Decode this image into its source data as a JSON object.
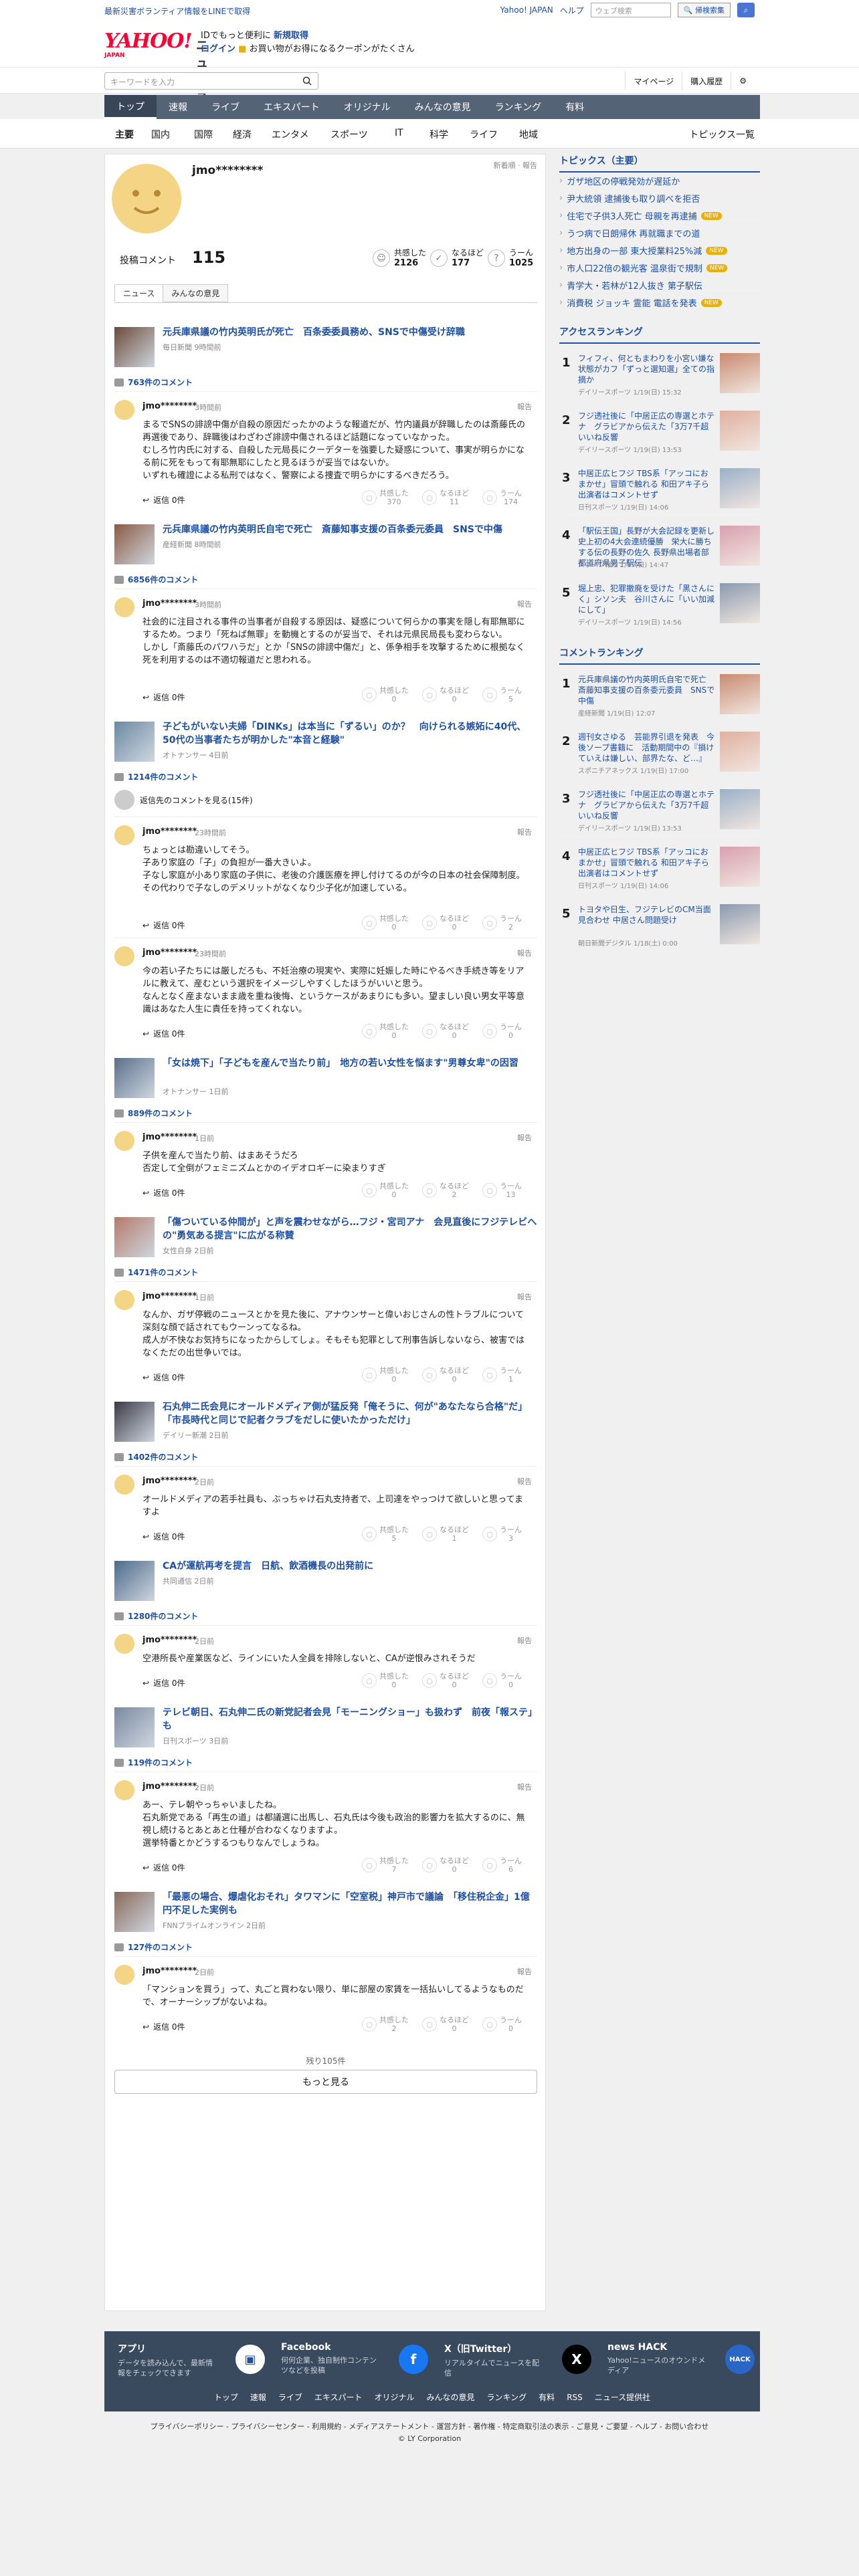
{
  "top_notice": {
    "left": "最新災害ボランティア情報をLINEで取得",
    "links": [
      "Yahoo! JAPAN",
      "ヘルプ"
    ],
    "search_placeholder": "ウェブ検索",
    "search_button": "🔍 帰検索集"
  },
  "header": {
    "logo_main": "YAHOO!",
    "logo_news": "ニュース",
    "logo_jp": "JAPAN",
    "promo_line1_a": "IDでもっと便利に",
    "promo_line1_b": "新規取得",
    "promo_line2_a": "ログイン",
    "promo_line2_b": "お買い物がお得になるクーポンがたくさん"
  },
  "search": {
    "placeholder": "キーワードを入力",
    "links": [
      "マイページ",
      "購入履歴"
    ]
  },
  "gnav": [
    "トップ",
    "速報",
    "ライブ",
    "エキスパート",
    "オリジナル",
    "みんなの意見",
    "ランキング",
    "有料"
  ],
  "subnav": [
    "主要",
    "国内",
    "国際",
    "経済",
    "エンタメ",
    "スポーツ",
    "IT",
    "科学",
    "ライフ",
    "地域"
  ],
  "topics_all": "トピックス一覧",
  "profile": {
    "name": "jmo********",
    "note": "新着順 · 報告",
    "post_label": "投稿コメント",
    "post_count": "115",
    "stats": [
      {
        "label": "共感した",
        "value": "2126"
      },
      {
        "label": "なるほど",
        "value": "177"
      },
      {
        "label": "うーん",
        "value": "1025"
      }
    ],
    "tabs": [
      "ニュース",
      "みんなの意見"
    ]
  },
  "articles": [
    {
      "title": "元兵庫県議の竹内英明氏が死亡　百条委委員務め、SNSで中傷受け辞職",
      "source": "毎日新聞 9時間前",
      "comments": "763件のコメント",
      "entries": [
        {
          "user": "jmo********",
          "time": "3時間前",
          "text": "まるでSNSの誹謗中傷が自殺の原因だったかのような報道だが、竹内議員が辞職したのは斎藤氏の再選後であり、辞職後はわざわざ誹謗中傷されるほど話題になっていなかった。\nむしろ竹内氏に対する、自殺した元局長にクーデターを強要した疑惑について、事実が明らかになる前に死をもって有耶無耶にしたと見るほうが妥当ではないか。\nいずれも確證による私刑ではなく、警察による捜査で明らかにするべきだろう。",
          "r": [
            "370",
            "11",
            "174"
          ]
        }
      ]
    },
    {
      "title": "元兵庫県議の竹内英明氏自宅で死亡　斎藤知事支援の百条委元委員　SNSで中傷",
      "source": "産経新聞 8時間前",
      "comments": "6856件のコメント",
      "entries": [
        {
          "user": "jmo********",
          "time": "3時間前",
          "text": "社会的に注目される事件の当事者が自殺する原因は、疑惑について何らかの事実を隠し有耶無耶にするため。つまり「死ねば無罪」を動機とするのが妥当で、それは元県民局長も変わらない。\nしかし「斎藤氏のパワハラだ」とか「SNSの誹謗中傷だ」と、係争相手を攻撃するために根拠なく死を利用するのは不適切報道だと思われる。",
          "r": [
            "0",
            "0",
            "5"
          ]
        }
      ]
    },
    {
      "title": "子どもがいない夫婦「DINKs」は本当に「ずるい」のか？　向けられる嫉妬に40代、50代の当事者たちが明かした\"本音と経験\"",
      "source": "オトナンサー 4日前",
      "comments": "1214件のコメント",
      "extra": "返信先のコメントを見る(15件)",
      "entries": [
        {
          "user": "jmo********",
          "time": "23時間前",
          "text": "ちょっとは勘違いしてそう。\n子あり家庭の「子」の負担が一番大きいよ。\n子なし家庭が小あり家庭の子供に、老後の介護医療を押し付けてるのが今の日本の社会保障制度。\nその代わりで子なしのデメリットがなくなり少子化が加速している。",
          "r": [
            "0",
            "0",
            "2"
          ]
        },
        {
          "user": "jmo********",
          "time": "23時間前",
          "text": "今の若い子たちには厳しだろも、不妊治療の現実や、実際に妊娠した時にやるべき手続き等をリアルに教えて、産むという選択をイメージしやすくしたほうがいいと思う。\nなんとなく産まないまま歳を重ね後悔、というケースがあまりにも多い。望ましい良い男女平等意識はあなた人生に責任を持ってくれない。",
          "r": [
            "0",
            "0",
            "0"
          ]
        }
      ]
    },
    {
      "title": "「女は焼下」「子どもを産んで当たり前」　地方の若い女性を悩ます\"男尊女卑\"の因習",
      "source": "オトナンサー 1日前",
      "comments": "889件のコメント",
      "entries": [
        {
          "user": "jmo********",
          "time": "1日前",
          "text": "子供を産んで当たり前、はまあそうだろ\n否定して全倒がフェミニズムとかのイデオロギーに染まりすぎ",
          "r": [
            "0",
            "2",
            "13"
          ]
        }
      ]
    },
    {
      "title": "「傷ついている仲間が」と声を震わせながら…フジ・宮司アナ　会見直後にフジテレビへの\"勇気ある提言\"に広がる称賛",
      "source": "女性自身 2日前",
      "comments": "1471件のコメント",
      "entries": [
        {
          "user": "jmo********",
          "time": "1日前",
          "text": "なんか、ガザ停戦のニュースとかを見た後に、アナウンサーと偉いおじさんの性トラブルについて深刻な顔で話されてもウーンってなるね。\n成人が不快なお気持ちになったからしてしょ。そもそも犯罪として刑事告訴しないなら、被害ではなくただの出世争いでは。",
          "r": [
            "0",
            "0",
            "1"
          ]
        }
      ]
    },
    {
      "title": "石丸伸二氏会見にオールドメディア側が猛反発「俺そうに、何が\"あなたなら合格\"だ」「市長時代と同じで記者クラブをだしに使いたかっただけ」",
      "source": "デイリー新潮 2日前",
      "comments": "1402件のコメント",
      "entries": [
        {
          "user": "jmo********",
          "time": "2日前",
          "text": "オールドメディアの若手社員も、ぶっちゃけ石丸支持者で、上司達をやっつけて欲しいと思ってますよ",
          "r": [
            "5",
            "1",
            "3"
          ]
        }
      ]
    },
    {
      "title": "CAが運航再考を提言　日航、飲酒機長の出発前に",
      "source": "共同通信 2日前",
      "comments": "1280件のコメント",
      "entries": [
        {
          "user": "jmo********",
          "time": "2日前",
          "text": "空港所長や産業医など、ラインにいた人全員を排除しないと、CAが逆恨みされそうだ",
          "r": [
            "0",
            "0",
            "0"
          ]
        }
      ]
    },
    {
      "title": "テレビ朝日、石丸伸二氏の新党記者会見「モーニングショー」も扱わず　前夜「報ステ」も",
      "source": "日刊スポーツ 3日前",
      "comments": "119件のコメント",
      "entries": [
        {
          "user": "jmo********",
          "time": "2日前",
          "text": "あー、テレ朝やっちゃいましたね。\n石丸新党である「再生の道」は都議選に出馬し、石丸氏は今後も政治的影響力を拡大するのに、無視し続けるとあとあと仕種が合わなくなりますよ。\n選挙特番とかどうするつもりなんでしょうね。",
          "r": [
            "7",
            "0",
            "6"
          ]
        }
      ]
    },
    {
      "title": "「最悪の場合、爆虐化おそれ」タワマンに「空室税」神戸市で議論　「移住税企金」1億円不足した実例も",
      "source": "FNNプライムオンライン 2日前",
      "comments": "127件のコメント",
      "entries": [
        {
          "user": "jmo********",
          "time": "2日前",
          "text": "「マンションを買う」って、丸ごと買わない限り、単に部屋の家賃を一括払いしてるようなものだで、オーナーシップがないよね。",
          "r": [
            "2",
            "0",
            "0"
          ]
        }
      ]
    }
  ],
  "reply_label": "返信 0件",
  "report_label": "報告",
  "react_labels": [
    "共感した",
    "なるほど",
    "うーん"
  ],
  "more": {
    "remaining": "残り105件",
    "button": "もっと見る"
  },
  "sidebar": {
    "topics_title": "トピックス（主要）",
    "topics": [
      {
        "t": "ガザ地区の停戦発効が遅延か",
        "b": ""
      },
      {
        "t": "尹大統領 逮捕後も取り調べを拒否",
        "b": ""
      },
      {
        "t": "住宅で子供3人死亡 母親を再逮捕",
        "b": "NEW"
      },
      {
        "t": "うつ病で日朗帰休 再就職までの道",
        "b": ""
      },
      {
        "t": "地方出身の一部 東大授業料25%減",
        "b": "NEW"
      },
      {
        "t": "市人口22倍の観光客 温泉街で規制",
        "b": "NEW"
      },
      {
        "t": "青学大・若林が12人抜き 第子駅伝",
        "b": ""
      },
      {
        "t": "消費税 ジョッキ 霊能 電話を発表",
        "b": "NEW"
      }
    ],
    "access_title": "アクセスランキング",
    "access": [
      {
        "t": "フィフィ、何ともまわりを小宮い嫌な状態がカフ「ずっと選知選」全ての指摘か",
        "s": "デイリースポーツ 1/19(日) 15:32"
      },
      {
        "t": "フジ透社後に「中居正広の専選とホテナ　グラビアから伝えた「3万7千超いいね反響",
        "s": "デイリースポーツ 1/19(日) 13:53"
      },
      {
        "t": "中居正広ヒフジ TBS系「アッコにおまかせ」冒頭で触れる 和田アキ子ら出演者はコメントせず",
        "s": "日刊スポーツ 1/19(日) 14:06"
      },
      {
        "t": "「駅伝王国」長野が大会記録を更新し史上初の4大会連続優勝　栄大に勝ちする伝の長野の佐久 長野県出場者部 都道府県男子駅伝",
        "s": "スポーツ報知 1/19(日) 14:47"
      },
      {
        "t": "堀上忠、犯罪撤廃を受けた「黒さんにく」シソン夫　谷川さんに「いい加減にして」",
        "s": "デイリースポーツ 1/19(日) 14:56"
      }
    ],
    "comment_title": "コメントランキング",
    "comment_rank": [
      {
        "t": "元兵庫県議の竹内英明氏自宅で死亡　斎藤知事支援の百条委元委員　SNSで中傷",
        "s": "産経新聞 1/19(日) 12:07"
      },
      {
        "t": "週刊女さゆる　芸能界引退を発表　今後ソープ書籍に　活動期間中の『損けていえは嫌しい、部界たな、ど…』",
        "s": "スポニチアネックス 1/19(日) 17:00"
      },
      {
        "t": "フジ透社後に「中居正広の専選とホテナ　グラビアから伝えた「3万7千超いいね反響",
        "s": "デイリースポーツ 1/19(日) 13:53"
      },
      {
        "t": "中居正広ヒフジ TBS系「アッコにおまかせ」冒頭で触れる 和田アキ子ら出演者はコメントせず",
        "s": "日刊スポーツ 1/19(日) 14:06"
      },
      {
        "t": "トヨタや日生、フジテレビのCM当面見合わせ 中居さん問題受け",
        "s": "朝日新聞デジタル 1/18(土) 0:00"
      }
    ]
  },
  "footer": {
    "apps": [
      {
        "t": "アプリ",
        "s": "データを読み込んで、最新情報をチェックできます",
        "i": "📰"
      },
      {
        "t": "Facebook",
        "s": "何何企業、独自制作コンテンツなどを投稿",
        "i": "f"
      },
      {
        "t": "X（旧Twitter）",
        "s": "リアルタイムでニュースを配信",
        "i": "𝕏"
      },
      {
        "t": "news HACK",
        "s": "Yahoo!ニュースのオウンドメディア",
        "i": "HACK"
      }
    ],
    "nav": [
      "トップ",
      "速報",
      "ライブ",
      "エキスパート",
      "オリジナル",
      "みんなの意見",
      "ランキング",
      "有料",
      "RSS",
      "ニュース提供社"
    ],
    "legal": "プライバシーポリシー - プライバシーセンター - 利用規約 - メディアステートメント - 運営方針 - 著作権 - 特定商取引法の表示 - ご意見・ご要望 - ヘルプ - お問い合わせ",
    "copyright": "© LY Corporation"
  },
  "colors": {
    "link": "#1d4fa3",
    "nav": "#556377",
    "footer": "#3a4a5e",
    "avatar": "#f3d585"
  }
}
